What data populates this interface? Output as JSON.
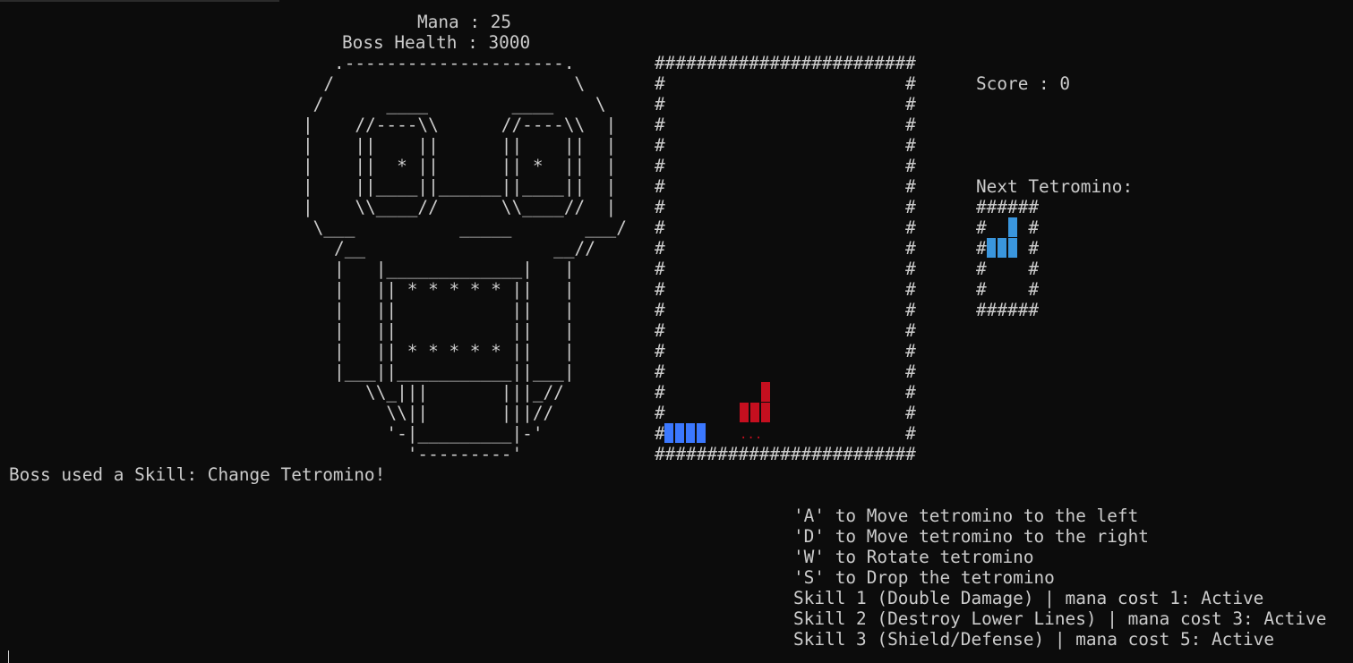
{
  "hud": {
    "mana_label": "Mana : 25",
    "boss_health_label": "Boss Health : 3000",
    "score_label": "Score : 0"
  },
  "boss_art": ".---------------------.\n/                       \\\n/      ____        ____    \\\n|    //----\\\\      //----\\\\  |\n|    ||    ||      ||    ||  |\n|    ||  * ||      || *  ||  |\n|    ||____||______||____||  |\n|    \\\\____//      \\\\____//  |\n\\___          _____       ___/\n/__                  __//\n|   |_____________|   |\n|   || * * * * * ||   |\n|   ||           ||   |\n|   ||           ||   |\n|   || * * * * * ||   |\n|___||___________||___|\n\\\\_|||       |||_//\n\\\\||       |||//\n'-|_________|-'\n'---------'",
  "board": {
    "border_char": "#",
    "columns": 12,
    "rows": 18,
    "settled_row_label": "...",
    "blue_color": "#3b78ff",
    "red_color": "#c50f1f"
  },
  "next_piece": {
    "label": "Next Tetromino:",
    "box_art": "######\n#    #\n#    #\n#    #\n#    #\n######",
    "color": "#3a96dd"
  },
  "message": "Boss used a Skill: Change Tetromino!",
  "controls": [
    "'A' to Move tetromino to the left",
    "'D' to Move tetromino to the right",
    "'W' to Rotate tetromino",
    "'S' to Drop the tetromino",
    "Skill 1 (Double Damage) | mana cost 1: Active",
    "Skill 2 (Destroy Lower Lines) | mana cost 3: Active",
    "Skill 3 (Shield/Defense) | mana cost 5: Active"
  ],
  "colors": {
    "background": "#0c0c0c",
    "text": "#cccccc"
  }
}
